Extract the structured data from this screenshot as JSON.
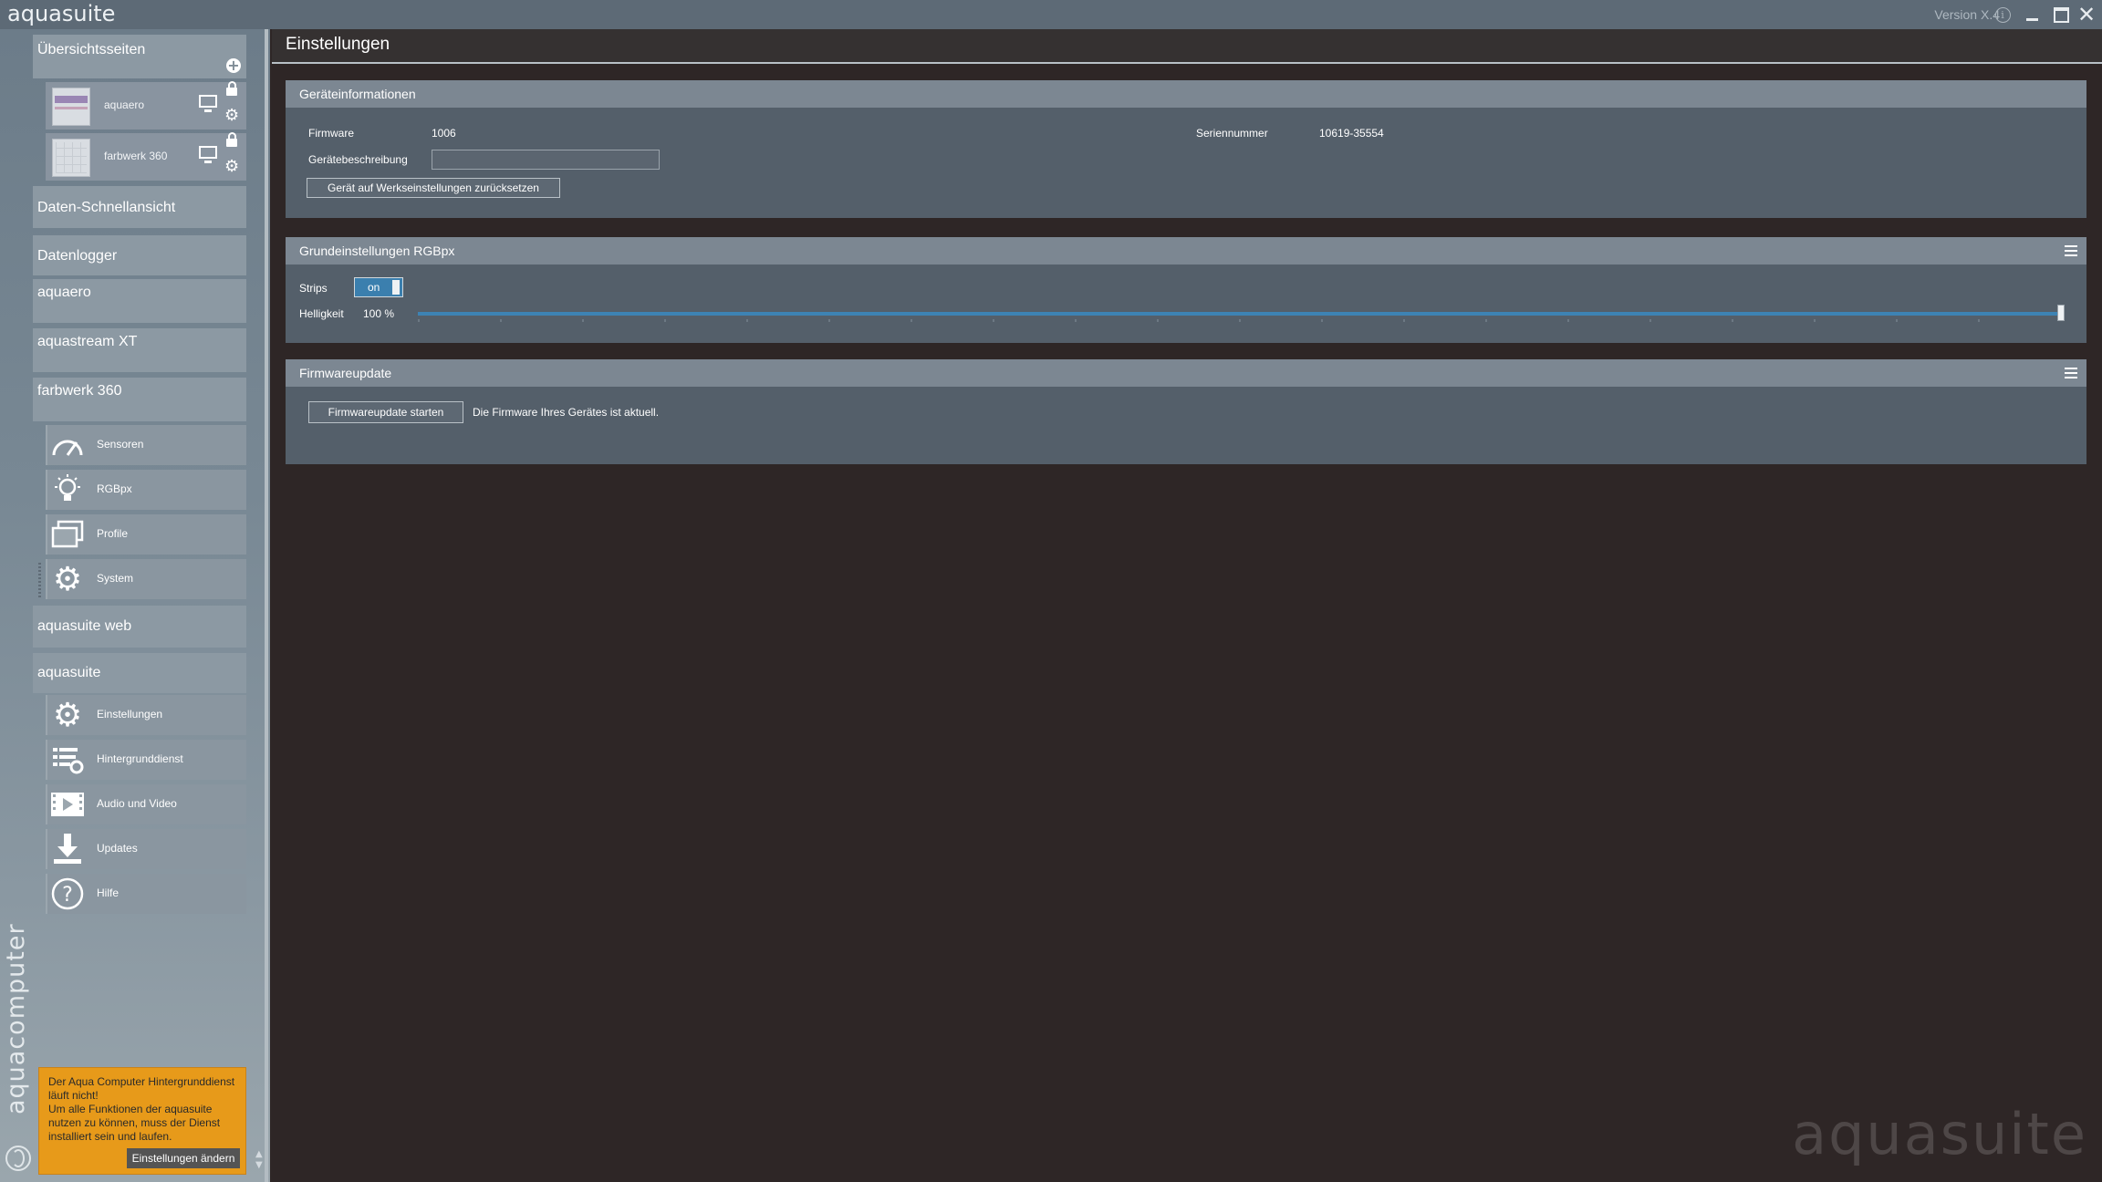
{
  "app": {
    "title": "aquasuite",
    "version": "Version X.4",
    "brand_vertical": "aquacomputer",
    "watermark": "aquasuite"
  },
  "window_controls": {
    "info_label": "i",
    "close_label": "✕"
  },
  "sidebar": {
    "overview": {
      "label": "Übersichtsseiten",
      "add_label": "+",
      "items": [
        {
          "name": "aquaero"
        },
        {
          "name": "farbwerk 360"
        }
      ]
    },
    "sections": {
      "quickview": "Daten-Schnellansicht",
      "datalogger": "Datenlogger",
      "aquaero": "aquaero",
      "aquastream": "aquastream XT",
      "farbwerk": "farbwerk 360",
      "aquasuite_web": "aquasuite web",
      "aquasuite": "aquasuite"
    },
    "farbwerk_items": [
      {
        "label": "Sensoren",
        "icon": "speedometer-icon"
      },
      {
        "label": "RGBpx",
        "icon": "lightbulb-icon"
      },
      {
        "label": "Profile",
        "icon": "profiles-icon"
      },
      {
        "label": "System",
        "icon": "gear-icon"
      }
    ],
    "aquasuite_items": [
      {
        "label": "Einstellungen",
        "icon": "gear-icon"
      },
      {
        "label": "Hintergrunddienst",
        "icon": "service-icon"
      },
      {
        "label": "Audio und Video",
        "icon": "video-icon"
      },
      {
        "label": "Updates",
        "icon": "download-icon"
      },
      {
        "label": "Hilfe",
        "icon": "help-icon"
      }
    ],
    "warning": {
      "text": "Der Aqua Computer Hintergrunddienst\nläuft nicht!\nUm alle Funktionen der aquasuite\nnutzen zu können, muss der Dienst\ninstalliert sein und laufen.",
      "button": "Einstellungen ändern"
    }
  },
  "main": {
    "title": "Einstellungen",
    "device_info": {
      "title": "Geräteinformationen",
      "firmware_label": "Firmware",
      "firmware_value": "1006",
      "serial_label": "Seriennummer",
      "serial_value": "10619-35554",
      "description_label": "Gerätebeschreibung",
      "description_value": "",
      "reset_button": "Gerät auf Werkseinstellungen zurücksetzen"
    },
    "rgbpx": {
      "title": "Grundeinstellungen RGBpx",
      "strips_label": "Strips",
      "strips_state": "on",
      "brightness_label": "Helligkeit",
      "brightness_value": "100 %",
      "brightness_fraction": 1.0
    },
    "firmware_update": {
      "title": "Firmwareupdate",
      "start_button": "Firmwareupdate starten",
      "status": "Die Firmware Ihres Gerätes ist aktuell."
    }
  },
  "colors": {
    "accent": "#3d83b4",
    "warning": "#e79a1a",
    "background": "#2e2626"
  }
}
